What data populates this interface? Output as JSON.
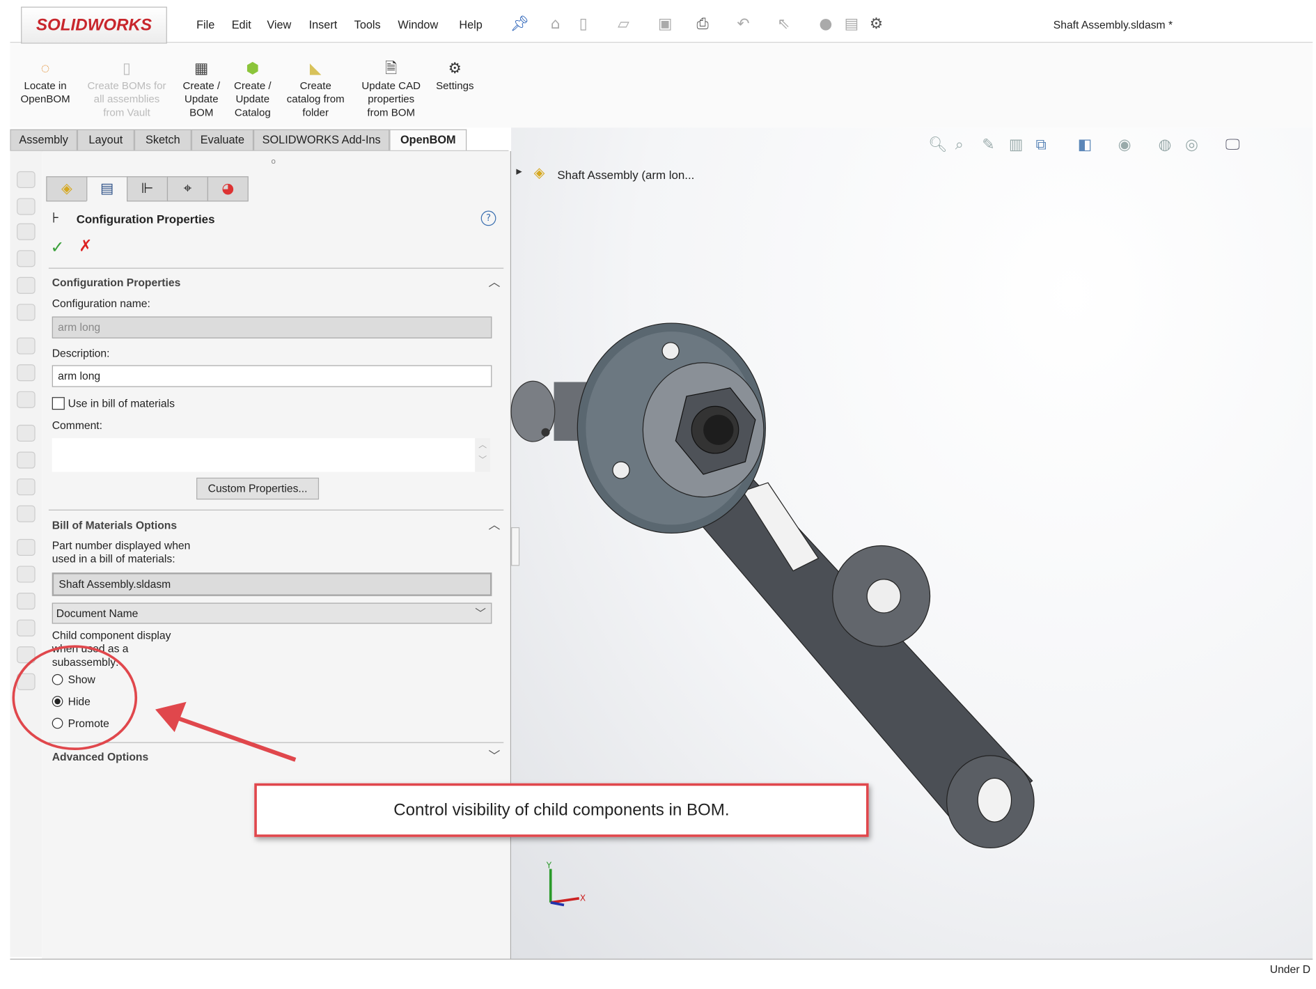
{
  "app": {
    "logo": "SOLIDWORKS",
    "title": "Shaft Assembly.sldasm *"
  },
  "menu": [
    "File",
    "Edit",
    "View",
    "Insert",
    "Tools",
    "Window",
    "Help"
  ],
  "ribbon": [
    {
      "label_lines": [
        "Locate in",
        "OpenBOM"
      ],
      "icon": "openbom-locate-icon",
      "enabled": true
    },
    {
      "label_lines": [
        "Create BOMs for",
        "all assemblies",
        "from Vault"
      ],
      "icon": "vault-bom-icon",
      "enabled": false
    },
    {
      "label_lines": [
        "Create /",
        "Update",
        "BOM"
      ],
      "icon": "grid-icon",
      "enabled": true
    },
    {
      "label_lines": [
        "Create /",
        "Update",
        "Catalog"
      ],
      "icon": "catalog-icon",
      "enabled": true
    },
    {
      "label_lines": [
        "Create",
        "catalog from",
        "folder"
      ],
      "icon": "folder-icon",
      "enabled": true
    },
    {
      "label_lines": [
        "Update CAD",
        "properties",
        "from BOM"
      ],
      "icon": "document-refresh-icon",
      "enabled": true
    },
    {
      "label_lines": [
        "Settings"
      ],
      "icon": "gear-icon",
      "enabled": true
    }
  ],
  "tabs": [
    {
      "label": "Assembly"
    },
    {
      "label": "Layout"
    },
    {
      "label": "Sketch"
    },
    {
      "label": "Evaluate"
    },
    {
      "label": "SOLIDWORKS Add-Ins"
    },
    {
      "label": "OpenBOM",
      "active": true
    }
  ],
  "panel": {
    "title": "Configuration Properties",
    "config_section": {
      "header": "Configuration Properties",
      "name_label": "Configuration name:",
      "name_value": "arm long",
      "description_label": "Description:",
      "description_value": "arm long",
      "use_in_bom_label": "Use in bill of materials",
      "use_in_bom_checked": false,
      "comment_label": "Comment:",
      "comment_value": "",
      "custom_properties_button": "Custom Properties..."
    },
    "bom_section": {
      "header": "Bill of Materials Options",
      "part_number_label_lines": [
        "Part number displayed when",
        "used in a bill of materials:"
      ],
      "part_number_value": "Shaft Assembly.sldasm",
      "part_number_source": "Document Name",
      "child_display_label_lines": [
        "Child component display",
        "when used as a",
        "subassembly:"
      ],
      "options": [
        {
          "label": "Show",
          "selected": false
        },
        {
          "label": "Hide",
          "selected": true
        },
        {
          "label": "Promote",
          "selected": false
        }
      ]
    },
    "advanced_section": {
      "header": "Advanced Options"
    }
  },
  "viewport": {
    "tree_item": "Shaft Assembly  (arm lon...",
    "axis_labels": {
      "x": "X",
      "y": "Y"
    }
  },
  "annotation": {
    "callout": "Control visibility of child components in BOM.",
    "color": "#e0474c"
  },
  "status": {
    "text": "Under D"
  }
}
